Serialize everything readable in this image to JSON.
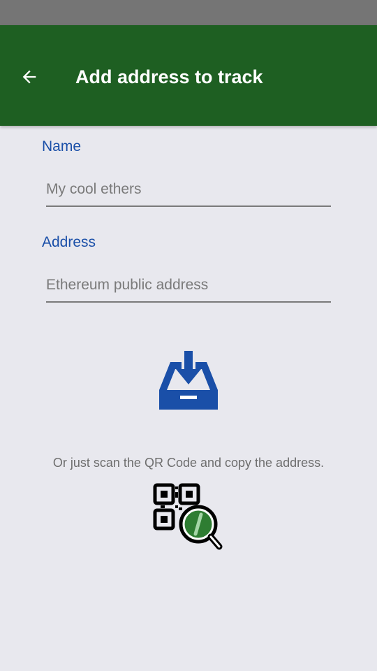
{
  "app_bar": {
    "title": "Add address to track",
    "back_icon": "arrow-back-icon",
    "color": "#1E5F22"
  },
  "form": {
    "name": {
      "label": "Name",
      "placeholder": "My cool ethers",
      "value": ""
    },
    "address": {
      "label": "Address",
      "placeholder": "Ethereum public address",
      "value": ""
    }
  },
  "import_icon": "inbox-download-icon",
  "hint": "Or just scan the QR Code and copy the address.",
  "qr_icon": "qr-scan-search-icon",
  "colors": {
    "accent": "#1A4FA8",
    "background": "#E8E8EE",
    "status_bar": "#757575"
  }
}
